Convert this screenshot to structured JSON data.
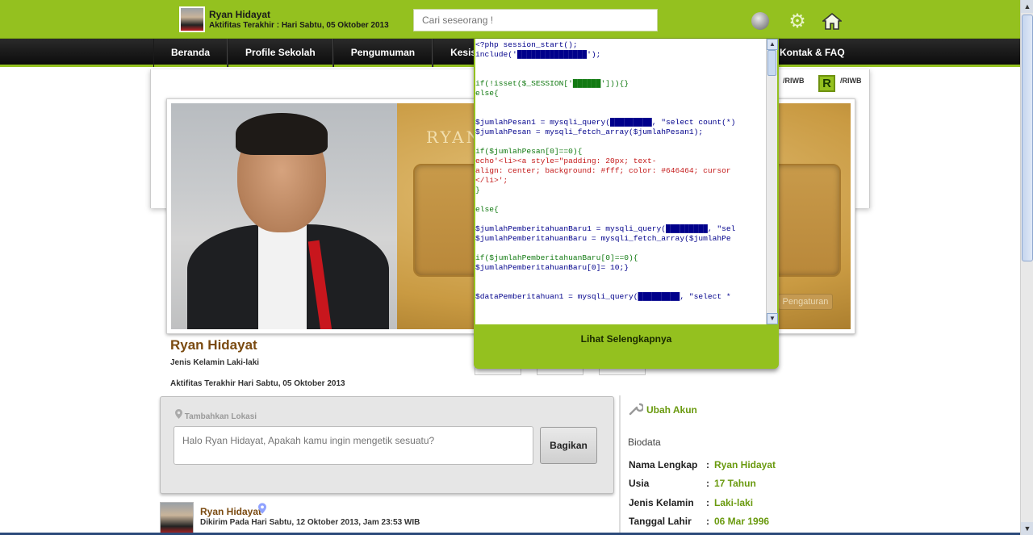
{
  "topbar": {
    "user_name": "Ryan Hidayat",
    "last_activity": "Aktifitas Terakhir : Hari Sabtu, 05 Oktober 2013",
    "search_placeholder": "Cari seseorang !",
    "icons": [
      "globe-icon",
      "gear-icon",
      "home-icon"
    ]
  },
  "nav": {
    "items": [
      "Beranda",
      "Profile Sekolah",
      "Pengumuman",
      "Kesiswaa"
    ],
    "right_item": "Kontak & FAQ"
  },
  "badges": {
    "riwb_left": "/RIWB",
    "r_badge": "R",
    "riwb_right": "/RIWB"
  },
  "cover": {
    "title": "RYAN",
    "button": "Pengaturan"
  },
  "profile": {
    "name": "Ryan Hidayat",
    "gender_label": "Jenis Kelamin",
    "gender_value": "Laki-laki",
    "activity_label": "Aktifitas Terakhir",
    "activity_value": "Hari Sabtu, 05 Oktober 2013"
  },
  "composer": {
    "location_label": "Tambahkan Lokasi",
    "placeholder": "Halo Ryan Hidayat, Apakah kamu ingin mengetik sesuatu?",
    "share_button": "Bagikan"
  },
  "post": {
    "author": "Ryan Hidayat",
    "sent_label": "Dikirim Pada",
    "sent_value": "Hari Sabtu, 12 Oktober 2013, Jam 23:53 WIB"
  },
  "sidebar": {
    "edit_account": "Ubah Akun",
    "biodata_title": "Biodata",
    "rows": [
      {
        "key": "Nama Lengkap",
        "sep": ":",
        "value": "Ryan Hidayat"
      },
      {
        "key": "Usia",
        "sep": ":",
        "value": "17 Tahun"
      },
      {
        "key": "Jenis Kelamin",
        "sep": ":",
        "value": "Laki-laki"
      },
      {
        "key": "Tanggal Lahir",
        "sep": ":",
        "value": "06 Mar 1996"
      }
    ]
  },
  "popup": {
    "code_lines": [
      "<?php session_start();",
      "include('███████████████');",
      "",
      "",
      "if(!isset($_SESSION['██████'])){}",
      "else{",
      "",
      "",
      "$jumlahPesan1 = mysqli_query(█████████, \"select count(*)",
      "$jumlahPesan = mysqli_fetch_array($jumlahPesan1);",
      "",
      "if($jumlahPesan[0]==0){",
      "echo'<li><a style=\"padding: 20px; text-",
      "align: center; background: #fff; color: #646464; cursor",
      "</li>';",
      "}",
      "",
      "else{",
      "",
      "$jumlahPemberitahuanBaru1 = mysqli_query(█████████, \"sel",
      "$jumlahPemberitahuanBaru = mysqli_fetch_array($jumlahPe",
      "",
      "if($jumlahPemberitahuanBaru[0]==0){",
      "$jumlahPemberitahuanBaru[0]= 10;}",
      "",
      "",
      "$dataPemberitahuan1 = mysqli_query(█████████, \"select * "
    ],
    "more_button": "Lihat Selengkapnya"
  }
}
